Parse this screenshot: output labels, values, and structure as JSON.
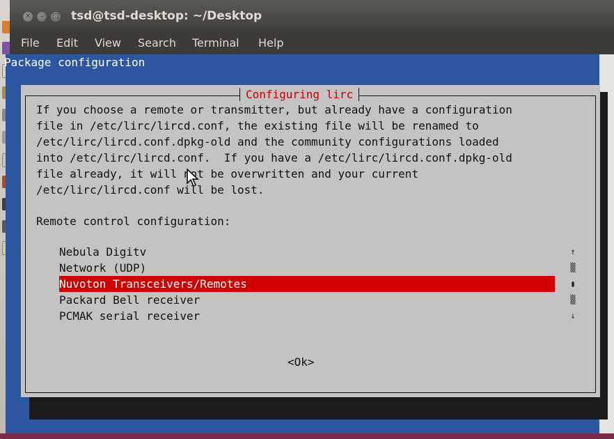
{
  "window": {
    "title": "tsd@tsd-desktop: ~/Desktop",
    "buttons": [
      "close-icon",
      "minimize-icon",
      "maximize-icon"
    ]
  },
  "menubar": {
    "items": [
      "File",
      "Edit",
      "View",
      "Search",
      "Terminal",
      "Help"
    ]
  },
  "terminal": {
    "header": "Package configuration"
  },
  "dialog": {
    "title": "Configuring lirc",
    "body_lines": [
      "If you choose a remote or transmitter, but already have a configuration",
      "file in /etc/lirc/lircd.conf, the existing file will be renamed to",
      "/etc/lirc/lircd.conf.dpkg-old and the community configurations loaded",
      "into /etc/lirc/lircd.conf.  If you have a /etc/lirc/lircd.conf.dpkg-old",
      "file already, it will not be overwritten and your current",
      "/etc/lirc/lircd.conf will be lost."
    ],
    "prompt": "Remote control configuration:",
    "options": [
      "Nebula Digitv",
      "Network (UDP)",
      "Nuvoton Transceivers/Remotes",
      "Packard Bell receiver",
      "PCMAK serial receiver"
    ],
    "selected_option": "Nuvoton Transceivers/Remotes",
    "scroll_glyphs": [
      "↑",
      "▒",
      "▮",
      "▒",
      "↓"
    ],
    "ok_label": "<Ok>"
  },
  "colors": {
    "terminal_bg": "#2d56a1",
    "dialog_bg": "#c3c3c3",
    "highlight": "#d10000",
    "title_text": "#c80000"
  }
}
